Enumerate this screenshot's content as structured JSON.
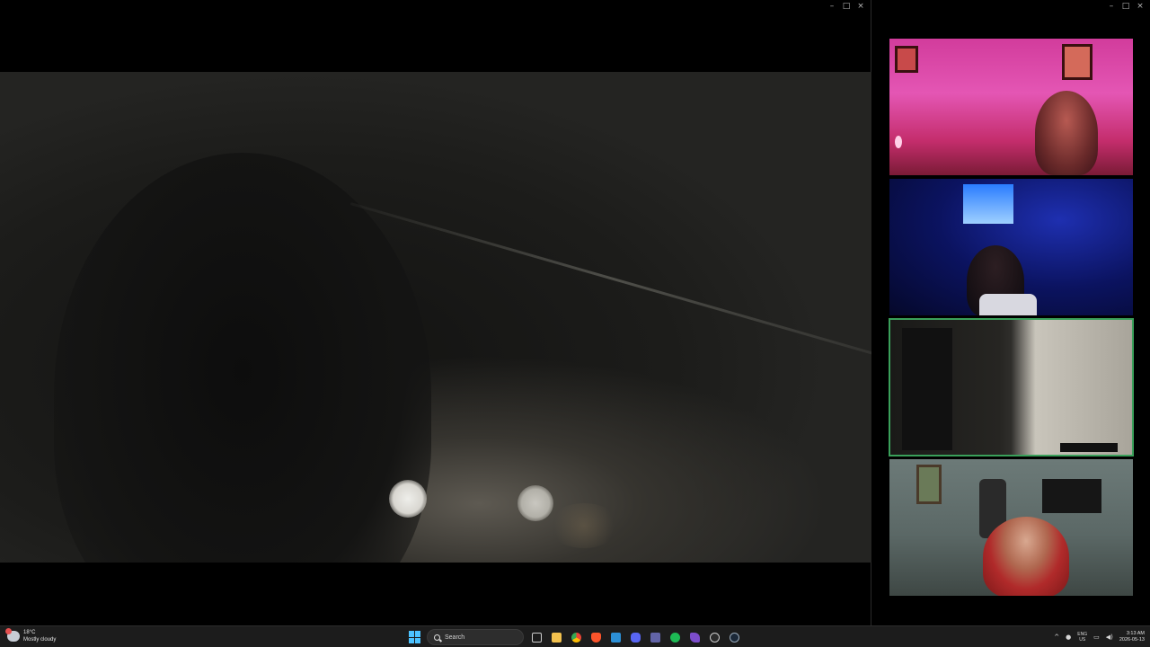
{
  "player_window": {
    "controls": {
      "minimize": "–",
      "maximize": "□",
      "close": "×"
    }
  },
  "call_window": {
    "controls": {
      "minimize": "–",
      "maximize": "□",
      "close": "×"
    },
    "participants": [
      {
        "active": false
      },
      {
        "active": false
      },
      {
        "active": true
      },
      {
        "active": false
      }
    ]
  },
  "taskbar": {
    "weather": {
      "temp": "18°C",
      "condition": "Mostly cloudy"
    },
    "search": {
      "label": "Search"
    },
    "apps": [
      {
        "name": "file-explorer",
        "color": "#f2c14e"
      },
      {
        "name": "chrome",
        "color": "#34a853"
      },
      {
        "name": "brave",
        "color": "#fb542b"
      },
      {
        "name": "vscode",
        "color": "#2c8fd6"
      },
      {
        "name": "discord",
        "color": "#5865f2"
      },
      {
        "name": "teams",
        "color": "#6264a7"
      },
      {
        "name": "spotify",
        "color": "#1db954"
      },
      {
        "name": "obsidian",
        "color": "#7c4dcc"
      },
      {
        "name": "obs",
        "color": "#444444"
      },
      {
        "name": "steam",
        "color": "#9ab"
      }
    ],
    "tray": {
      "lang_top": "ENG",
      "lang_bottom": "US",
      "time": "3:13 AM",
      "date": "2026-05-13"
    }
  }
}
